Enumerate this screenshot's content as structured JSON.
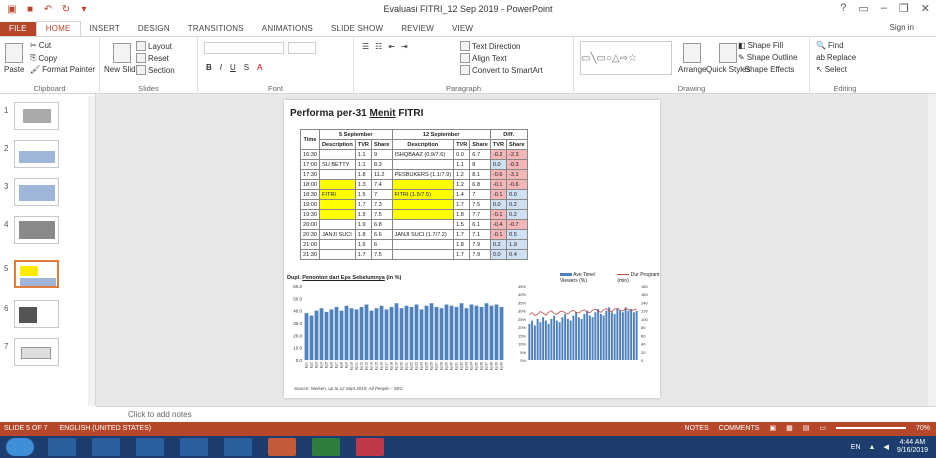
{
  "window": {
    "title": "Evaluasi FITRI_12 Sep 2019 - PowerPoint",
    "signin": "Sign in"
  },
  "tabs": [
    "FILE",
    "HOME",
    "INSERT",
    "DESIGN",
    "TRANSITIONS",
    "ANIMATIONS",
    "SLIDE SHOW",
    "REVIEW",
    "VIEW"
  ],
  "ribbon": {
    "clipboard": {
      "label": "Clipboard",
      "paste": "Paste",
      "cut": "Cut",
      "copy": "Copy",
      "format_painter": "Format Painter"
    },
    "slides": {
      "label": "Slides",
      "new_slide": "New Slide",
      "layout": "Layout",
      "reset": "Reset",
      "section": "Section"
    },
    "font": {
      "label": "Font"
    },
    "paragraph": {
      "label": "Paragraph",
      "text_direction": "Text Direction",
      "align_text": "Align Text",
      "convert": "Convert to SmartArt"
    },
    "drawing": {
      "label": "Drawing",
      "arrange": "Arrange",
      "quick_styles": "Quick Styles",
      "shape_fill": "Shape Fill",
      "shape_outline": "Shape Outline",
      "shape_effects": "Shape Effects"
    },
    "editing": {
      "label": "Editing",
      "find": "Find",
      "replace": "Replace",
      "select": "Select"
    }
  },
  "thumbnails": [
    "1",
    "2",
    "3",
    "4",
    "5",
    "6",
    "7"
  ],
  "slide": {
    "title_prefix": "Performa per-31 ",
    "title_menit": "Menit",
    "title_suffix": " FITRI",
    "table": {
      "group_headers": [
        "5 September",
        "12 September",
        "Diff."
      ],
      "col_headers": [
        "Time",
        "Description",
        "TVR",
        "Share",
        "Description",
        "TVR",
        "Share",
        "TVR",
        "Share"
      ],
      "rows": [
        [
          "16:30",
          "",
          "1.1",
          "9",
          "ISHQBAAZ (0.9/7.6)",
          "0.9",
          "6.7",
          "-0.2",
          "-2.3"
        ],
        [
          "17:00",
          "SU BETTY",
          "1.1",
          "8.3",
          "",
          "1.1",
          "8",
          "0.0",
          "-0.3"
        ],
        [
          "17:30",
          "",
          "1.8",
          "11.2",
          "PESBUKERS (1.1/7.9)",
          "1.2",
          "8.1",
          "-0.6",
          "-3.1"
        ],
        [
          "18:00",
          "",
          "1.3",
          "7.4",
          "",
          "1.2",
          "6.8",
          "-0.1",
          "-0.6"
        ],
        [
          "18:30",
          "FITRI",
          "1.5",
          "7",
          "FITRI (1.5/7.5)",
          "1.4",
          "7",
          "-0.1",
          "0.0"
        ],
        [
          "19:00",
          "",
          "1.7",
          "7.3",
          "",
          "1.7",
          "7.5",
          "0.0",
          "0.2"
        ],
        [
          "19:30",
          "",
          "1.9",
          "7.5",
          "",
          "1.8",
          "7.7",
          "-0.1",
          "0.2"
        ],
        [
          "20:00",
          "",
          "1.9",
          "6.8",
          "",
          "1.5",
          "6.1",
          "-0.4",
          "-0.7"
        ],
        [
          "20:30",
          "JANJI SUCI",
          "1.8",
          "6.6",
          "JANJI SUCI (1.7/7.2)",
          "1.7",
          "7.1",
          "-0.1",
          "0.5"
        ],
        [
          "21:00",
          "",
          "1.6",
          "6",
          "",
          "1.8",
          "7.9",
          "0.2",
          "1.9"
        ],
        [
          "21:30",
          "",
          "1.7",
          "7.5",
          "",
          "1.7",
          "7.9",
          "0.0",
          "0.4"
        ]
      ]
    },
    "chart_title_prefix": "Dupl. ",
    "chart_title_link": "Penonton dari Eps Sebelumnya",
    "chart_title_suffix": " (in %)",
    "legend": [
      "Ave Time/ Viewers (%)",
      "Dur Program (min)"
    ],
    "source": "Source: Nielsen, up to 12 Sept 2019, All People – SEC"
  },
  "chart_data": [
    {
      "type": "bar",
      "title": "",
      "ylim": [
        0,
        60
      ],
      "yticks": [
        "60.0",
        "50.0",
        "40.0",
        "30.0",
        "20.0",
        "10.0",
        "0.0"
      ],
      "categories": [
        "Ep1",
        "Ep2",
        "Ep3",
        "Ep4",
        "Ep5",
        "Ep6",
        "Ep7",
        "Ep8",
        "Ep9",
        "Ep10",
        "Ep11",
        "Ep12",
        "Ep13",
        "Ep14",
        "Ep15",
        "Ep16",
        "Ep17",
        "Ep18",
        "Ep19",
        "Ep20",
        "Ep21",
        "Ep22",
        "Ep23",
        "Ep24",
        "Ep25",
        "Ep26",
        "Ep27",
        "Ep28",
        "Ep29",
        "Ep30",
        "Ep31",
        "Ep32",
        "Ep33",
        "Ep34",
        "Ep35",
        "Ep36",
        "Ep37",
        "Ep38",
        "Ep39",
        "Ep40"
      ],
      "values": [
        38,
        36,
        40,
        42,
        39,
        41,
        43,
        40,
        44,
        42,
        41,
        43,
        45,
        40,
        42,
        44,
        41,
        43,
        46,
        42,
        44,
        43,
        45,
        41,
        44,
        46,
        43,
        42,
        45,
        44,
        43,
        46,
        42,
        45,
        44,
        43,
        46,
        44,
        45,
        43
      ]
    },
    {
      "type": "bar",
      "title": "",
      "ylim": [
        0,
        45
      ],
      "yticks": [
        "45%",
        "40%",
        "35%",
        "30%",
        "25%",
        "20%",
        "15%",
        "10%",
        "5%",
        "0%"
      ],
      "y2ticks": [
        "180",
        "160",
        "140",
        "120",
        "100",
        "80",
        "60",
        "40",
        "20",
        "0"
      ],
      "series": [
        {
          "name": "Ave Time/ Viewers (%)",
          "values": [
            22,
            24,
            21,
            25,
            23,
            26,
            24,
            22,
            25,
            27,
            24,
            23,
            26,
            28,
            25,
            24,
            27,
            29,
            26,
            25,
            28,
            30,
            27,
            26,
            29,
            31,
            28,
            27,
            30,
            32,
            29,
            28,
            31,
            30,
            29,
            32,
            30,
            31,
            29,
            30
          ]
        },
        {
          "name": "Dur Program (min)",
          "values": [
            110,
            115,
            108,
            112,
            118,
            114,
            109,
            116,
            120,
            113,
            111,
            117,
            119,
            115,
            112,
            118,
            121,
            116,
            114,
            120,
            122,
            117,
            115,
            121,
            124,
            119,
            116,
            122,
            125,
            120,
            118,
            124,
            126,
            121,
            119,
            125,
            123,
            120,
            122,
            124
          ]
        }
      ]
    }
  ],
  "notes": "Click to add notes",
  "status": {
    "slide": "SLIDE 5 OF 7",
    "lang": "ENGLISH (UNITED STATES)",
    "notes": "NOTES",
    "comments": "COMMENTS",
    "zoom": "70%"
  },
  "tray": {
    "lang": "EN",
    "time": "4:44 AM",
    "date": "9/16/2019"
  }
}
